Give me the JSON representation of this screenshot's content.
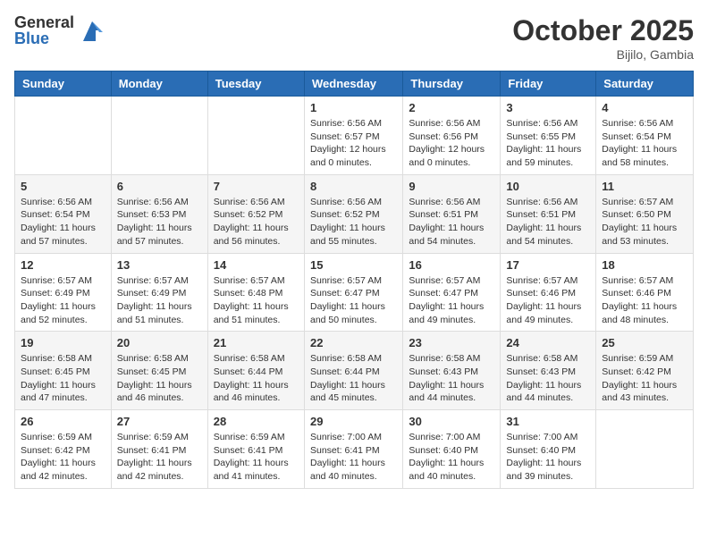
{
  "header": {
    "logo_general": "General",
    "logo_blue": "Blue",
    "month_title": "October 2025",
    "location": "Bijilo, Gambia"
  },
  "days_of_week": [
    "Sunday",
    "Monday",
    "Tuesday",
    "Wednesday",
    "Thursday",
    "Friday",
    "Saturday"
  ],
  "weeks": [
    [
      {
        "day": "",
        "info": ""
      },
      {
        "day": "",
        "info": ""
      },
      {
        "day": "",
        "info": ""
      },
      {
        "day": "1",
        "info": "Sunrise: 6:56 AM\nSunset: 6:57 PM\nDaylight: 12 hours\nand 0 minutes."
      },
      {
        "day": "2",
        "info": "Sunrise: 6:56 AM\nSunset: 6:56 PM\nDaylight: 12 hours\nand 0 minutes."
      },
      {
        "day": "3",
        "info": "Sunrise: 6:56 AM\nSunset: 6:55 PM\nDaylight: 11 hours\nand 59 minutes."
      },
      {
        "day": "4",
        "info": "Sunrise: 6:56 AM\nSunset: 6:54 PM\nDaylight: 11 hours\nand 58 minutes."
      }
    ],
    [
      {
        "day": "5",
        "info": "Sunrise: 6:56 AM\nSunset: 6:54 PM\nDaylight: 11 hours\nand 57 minutes."
      },
      {
        "day": "6",
        "info": "Sunrise: 6:56 AM\nSunset: 6:53 PM\nDaylight: 11 hours\nand 57 minutes."
      },
      {
        "day": "7",
        "info": "Sunrise: 6:56 AM\nSunset: 6:52 PM\nDaylight: 11 hours\nand 56 minutes."
      },
      {
        "day": "8",
        "info": "Sunrise: 6:56 AM\nSunset: 6:52 PM\nDaylight: 11 hours\nand 55 minutes."
      },
      {
        "day": "9",
        "info": "Sunrise: 6:56 AM\nSunset: 6:51 PM\nDaylight: 11 hours\nand 54 minutes."
      },
      {
        "day": "10",
        "info": "Sunrise: 6:56 AM\nSunset: 6:51 PM\nDaylight: 11 hours\nand 54 minutes."
      },
      {
        "day": "11",
        "info": "Sunrise: 6:57 AM\nSunset: 6:50 PM\nDaylight: 11 hours\nand 53 minutes."
      }
    ],
    [
      {
        "day": "12",
        "info": "Sunrise: 6:57 AM\nSunset: 6:49 PM\nDaylight: 11 hours\nand 52 minutes."
      },
      {
        "day": "13",
        "info": "Sunrise: 6:57 AM\nSunset: 6:49 PM\nDaylight: 11 hours\nand 51 minutes."
      },
      {
        "day": "14",
        "info": "Sunrise: 6:57 AM\nSunset: 6:48 PM\nDaylight: 11 hours\nand 51 minutes."
      },
      {
        "day": "15",
        "info": "Sunrise: 6:57 AM\nSunset: 6:47 PM\nDaylight: 11 hours\nand 50 minutes."
      },
      {
        "day": "16",
        "info": "Sunrise: 6:57 AM\nSunset: 6:47 PM\nDaylight: 11 hours\nand 49 minutes."
      },
      {
        "day": "17",
        "info": "Sunrise: 6:57 AM\nSunset: 6:46 PM\nDaylight: 11 hours\nand 49 minutes."
      },
      {
        "day": "18",
        "info": "Sunrise: 6:57 AM\nSunset: 6:46 PM\nDaylight: 11 hours\nand 48 minutes."
      }
    ],
    [
      {
        "day": "19",
        "info": "Sunrise: 6:58 AM\nSunset: 6:45 PM\nDaylight: 11 hours\nand 47 minutes."
      },
      {
        "day": "20",
        "info": "Sunrise: 6:58 AM\nSunset: 6:45 PM\nDaylight: 11 hours\nand 46 minutes."
      },
      {
        "day": "21",
        "info": "Sunrise: 6:58 AM\nSunset: 6:44 PM\nDaylight: 11 hours\nand 46 minutes."
      },
      {
        "day": "22",
        "info": "Sunrise: 6:58 AM\nSunset: 6:44 PM\nDaylight: 11 hours\nand 45 minutes."
      },
      {
        "day": "23",
        "info": "Sunrise: 6:58 AM\nSunset: 6:43 PM\nDaylight: 11 hours\nand 44 minutes."
      },
      {
        "day": "24",
        "info": "Sunrise: 6:58 AM\nSunset: 6:43 PM\nDaylight: 11 hours\nand 44 minutes."
      },
      {
        "day": "25",
        "info": "Sunrise: 6:59 AM\nSunset: 6:42 PM\nDaylight: 11 hours\nand 43 minutes."
      }
    ],
    [
      {
        "day": "26",
        "info": "Sunrise: 6:59 AM\nSunset: 6:42 PM\nDaylight: 11 hours\nand 42 minutes."
      },
      {
        "day": "27",
        "info": "Sunrise: 6:59 AM\nSunset: 6:41 PM\nDaylight: 11 hours\nand 42 minutes."
      },
      {
        "day": "28",
        "info": "Sunrise: 6:59 AM\nSunset: 6:41 PM\nDaylight: 11 hours\nand 41 minutes."
      },
      {
        "day": "29",
        "info": "Sunrise: 7:00 AM\nSunset: 6:41 PM\nDaylight: 11 hours\nand 40 minutes."
      },
      {
        "day": "30",
        "info": "Sunrise: 7:00 AM\nSunset: 6:40 PM\nDaylight: 11 hours\nand 40 minutes."
      },
      {
        "day": "31",
        "info": "Sunrise: 7:00 AM\nSunset: 6:40 PM\nDaylight: 11 hours\nand 39 minutes."
      },
      {
        "day": "",
        "info": ""
      }
    ]
  ]
}
